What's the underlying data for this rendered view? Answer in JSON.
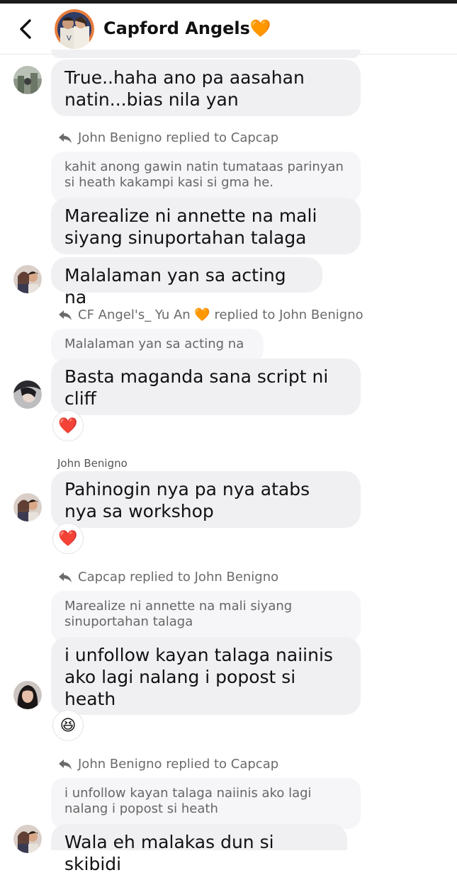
{
  "header": {
    "title": "Capford Angels🧡"
  },
  "messages": [
    {
      "text": "True..haha ano pa aasahan natin...bias nila yan"
    },
    {
      "replied": "John Benigno replied to Capcap",
      "quote": "kahit anong gawin natin tumataas parinyan si heath kakampi kasi si gma he.",
      "text": "Marealize ni annette na mali siyang sinuportahan talaga"
    },
    {
      "text": "Malalaman yan sa acting na"
    },
    {
      "replied": "CF Angel's_ Yu An 🧡 replied to John Benigno",
      "quote": "Malalaman yan sa acting na",
      "text": "Basta maganda sana script ni cliff",
      "reaction": "❤️"
    },
    {
      "sender": "John Benigno",
      "text": "Pahinogin nya pa nya atabs nya sa workshop",
      "reaction": "❤️"
    },
    {
      "replied": "Capcap replied to John Benigno",
      "quote": "Marealize ni annette na mali siyang sinuportahan talaga",
      "text": "i unfollow kayan talaga naiinis ako lagi nalang i popost si heath",
      "reaction": "😆"
    },
    {
      "replied": "John Benigno replied to Capcap",
      "quote": "i unfollow kayan talaga naiinis ako lagi nalang i popost si heath",
      "text": "Wala eh malakas dun si skibidi"
    }
  ]
}
